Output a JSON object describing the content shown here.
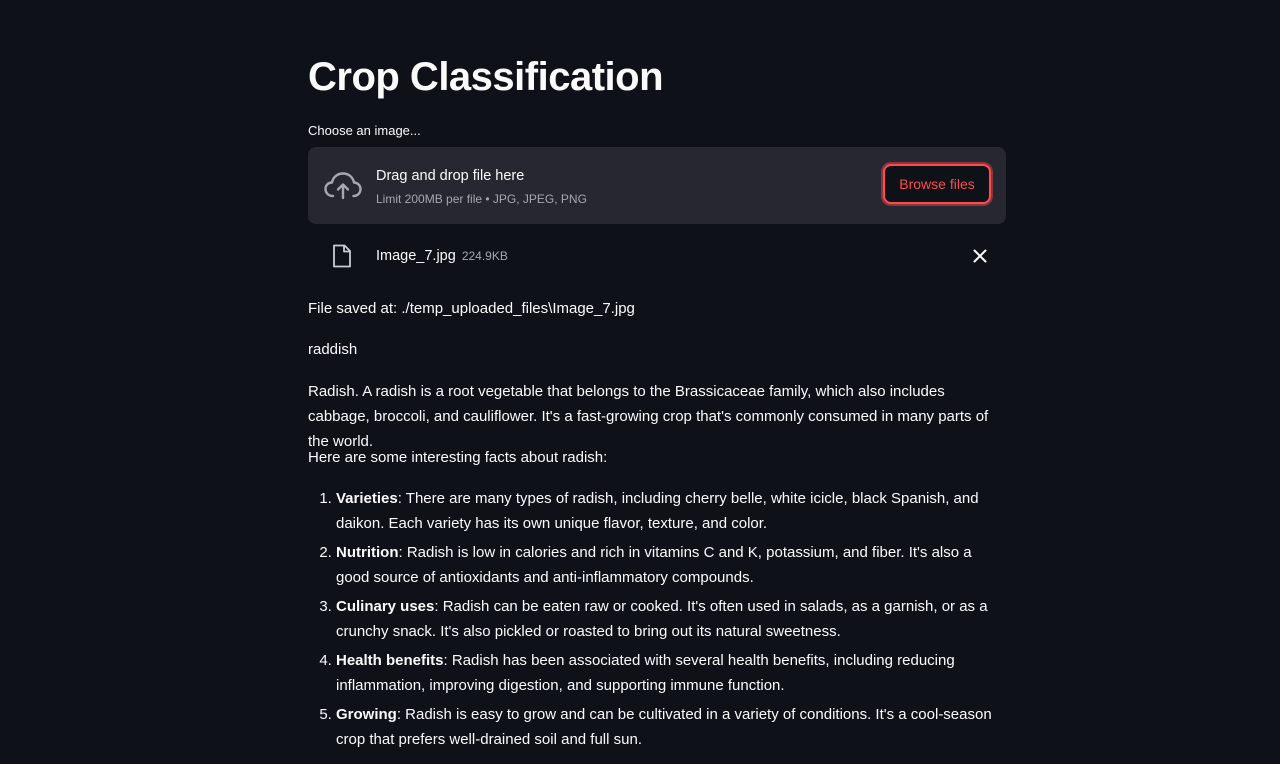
{
  "page": {
    "title": "Crop Classification"
  },
  "uploader": {
    "label": "Choose an image...",
    "drop_title": "Drag and drop file here",
    "limit_text": "Limit 200MB per file • JPG, JPEG, PNG",
    "browse_label": "Browse files",
    "icon": "cloud-upload-icon"
  },
  "uploaded_file": {
    "name": "Image_7.jpg",
    "size": "224.9KB",
    "icon": "file-icon",
    "remove_icon": "close-icon"
  },
  "output": {
    "saved_path": "File saved at: ./temp_uploaded_files\\Image_7.jpg",
    "prediction": "raddish",
    "description": "Radish. A radish is a root vegetable that belongs to the Brassicaceae family, which also includes cabbage, broccoli, and cauliflower. It's a fast-growing crop that's commonly consumed in many parts of the world.",
    "facts_intro": "Here are some interesting facts about radish:",
    "facts": [
      {
        "title": "Varieties",
        "text": ": There are many types of radish, including cherry belle, white icicle, black Spanish, and daikon. Each variety has its own unique flavor, texture, and color."
      },
      {
        "title": "Nutrition",
        "text": ": Radish is low in calories and rich in vitamins C and K, potassium, and fiber. It's also a good source of antioxidants and anti-inflammatory compounds."
      },
      {
        "title": "Culinary uses",
        "text": ": Radish can be eaten raw or cooked. It's often used in salads, as a garnish, or as a crunchy snack. It's also pickled or roasted to bring out its natural sweetness."
      },
      {
        "title": "Health benefits",
        "text": ": Radish has been associated with several health benefits, including reducing inflammation, improving digestion, and supporting immune function."
      },
      {
        "title": "Growing",
        "text": ": Radish is easy to grow and can be cultivated in a variety of conditions. It's a cool-season crop that prefers well-drained soil and full sun."
      }
    ]
  },
  "colors": {
    "background": "#0e1117",
    "surface": "#262730",
    "text": "#fafafa",
    "muted": "#a3a8b4",
    "accent": "#ff4b4b"
  }
}
